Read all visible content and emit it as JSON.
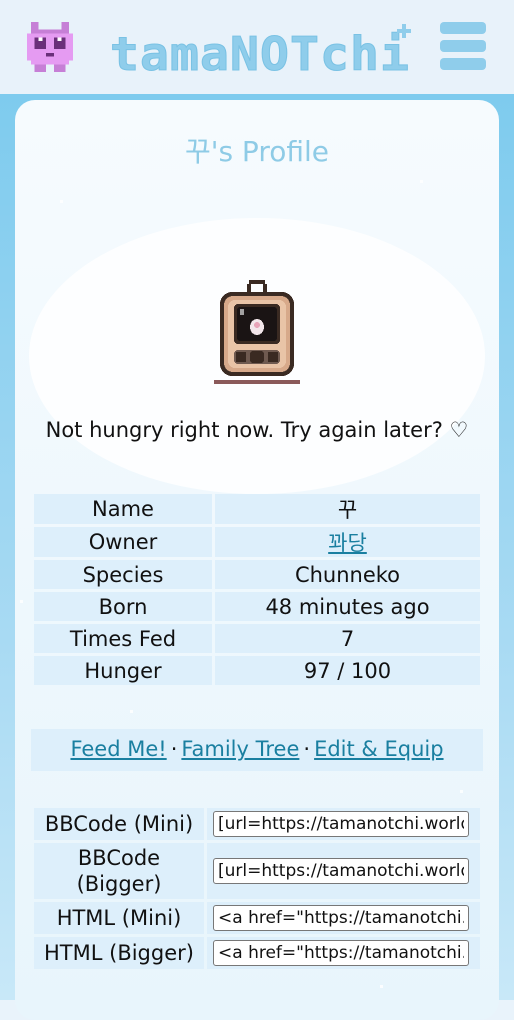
{
  "header": {
    "logo_text": "tamaNOTchi",
    "logo_icon": "pink-pet-icon",
    "menu_icon": "hamburger-menu-icon"
  },
  "profile": {
    "title": "꾸's Profile",
    "pet_icon": "tamagotchi-device-icon",
    "status_message": "Not hungry right now. Try again later? ♡"
  },
  "info": {
    "rows": [
      {
        "label": "Name",
        "value": "꾸"
      },
      {
        "label": "Owner",
        "value": "꽈당"
      },
      {
        "label": "Species",
        "value": "Chunneko"
      },
      {
        "label": "Born",
        "value": "48 minutes ago"
      },
      {
        "label": "Times Fed",
        "value": "7"
      },
      {
        "label": "Hunger",
        "value": "97 / 100"
      }
    ]
  },
  "actions": {
    "feed": "Feed Me!",
    "family_tree": "Family Tree",
    "edit_equip": "Edit & Equip",
    "separator": "·"
  },
  "codes": {
    "rows": [
      {
        "label": "BBCode (Mini)",
        "value": "[url=https://tamanotchi.world/"
      },
      {
        "label": "BBCode (Bigger)",
        "value": "[url=https://tamanotchi.world/"
      },
      {
        "label": "HTML (Mini)",
        "value": "<a href=\"https://tamanotchi.wo"
      },
      {
        "label": "HTML (Bigger)",
        "value": "<a href=\"https://tamanotchi.wo"
      }
    ]
  },
  "colors": {
    "accent": "#8ecbe6",
    "link": "#1a7fa0",
    "cell": "#ddeffb",
    "logo_pet": "#e59bf2"
  }
}
